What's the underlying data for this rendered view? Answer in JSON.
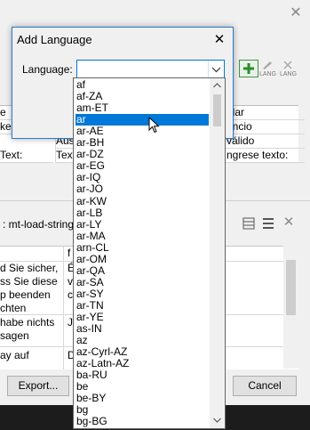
{
  "dialog": {
    "title": "Add Language",
    "label": "Language:",
    "input_value": ""
  },
  "dropdown": {
    "options": [
      "af",
      "af-ZA",
      "am-ET",
      "ar",
      "ar-AE",
      "ar-BH",
      "ar-DZ",
      "ar-EG",
      "ar-IQ",
      "ar-JO",
      "ar-KW",
      "ar-LB",
      "ar-LY",
      "ar-MA",
      "arn-CL",
      "ar-OM",
      "ar-QA",
      "ar-SA",
      "ar-SY",
      "ar-TN",
      "ar-YE",
      "as-IN",
      "az",
      "az-Cyrl-AZ",
      "az-Latn-AZ",
      "ba-RU",
      "be",
      "be-BY",
      "bg",
      "bg-BG"
    ],
    "selected": "ar"
  },
  "background": {
    "toolbar": {
      "lang_label": "LANG"
    },
    "table_rows": [
      {
        "c1": "e",
        "c2": "",
        "c3": "blar"
      },
      {
        "c1": "ke",
        "c2": "",
        "c3": "encio"
      },
      {
        "c1": "",
        "c2": "Aus",
        "c3": "válido"
      },
      {
        "c1": "Text:",
        "c2": "Text",
        "c3": "ngrese texto:"
      }
    ],
    "status_text": ": mt-load-string('",
    "list_header": "f",
    "list_rows": [
      {
        "left": "d Sie sicher,\nss Sie diese\np beenden\nchten",
        "right": "É\nv\nc"
      },
      {
        "left": "habe nichts\nsagen",
        "right": "J"
      },
      {
        "left": "ay auf",
        "right": "D"
      }
    ],
    "export_button": "Export...",
    "cancel_button": "Cancel"
  }
}
